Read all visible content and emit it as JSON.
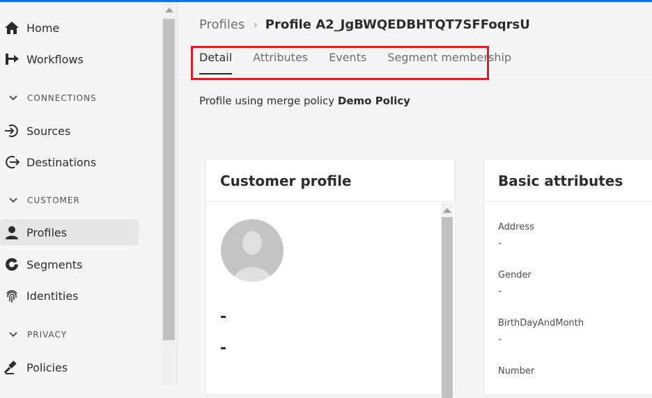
{
  "sidebar": {
    "items": [
      {
        "label": "Home",
        "icon": "home-icon"
      },
      {
        "label": "Workflows",
        "icon": "workflows-icon"
      },
      {
        "label": "Sources",
        "icon": "sources-icon"
      },
      {
        "label": "Destinations",
        "icon": "destinations-icon"
      },
      {
        "label": "Profiles",
        "icon": "user-icon",
        "selected": true
      },
      {
        "label": "Segments",
        "icon": "segments-icon"
      },
      {
        "label": "Identities",
        "icon": "fingerprint-icon"
      },
      {
        "label": "Policies",
        "icon": "gavel-icon"
      }
    ],
    "sections": [
      "CONNECTIONS",
      "CUSTOMER",
      "PRIVACY"
    ]
  },
  "breadcrumb": {
    "parent": "Profiles",
    "separator": "›",
    "current": "Profile A2_JgBWQEDBHTQT7SFFoqrsU"
  },
  "tabs": [
    "Detail",
    "Attributes",
    "Events",
    "Segment membership"
  ],
  "active_tab": "Detail",
  "merge_policy": {
    "prefix": "Profile using merge policy",
    "name": "Demo Policy"
  },
  "customer_profile": {
    "title": "Customer profile",
    "line1": "-",
    "line2": "-"
  },
  "basic_attributes": {
    "title": "Basic attributes",
    "fields": [
      {
        "label": "Address",
        "value": "-"
      },
      {
        "label": "Gender",
        "value": "-"
      },
      {
        "label": "BirthDayAndMonth",
        "value": "-"
      },
      {
        "label": "Number",
        "value": ""
      }
    ]
  },
  "colors": {
    "accent": "#1473e6",
    "highlight": "#e01d25",
    "selected_bg": "#e6e6e6"
  }
}
